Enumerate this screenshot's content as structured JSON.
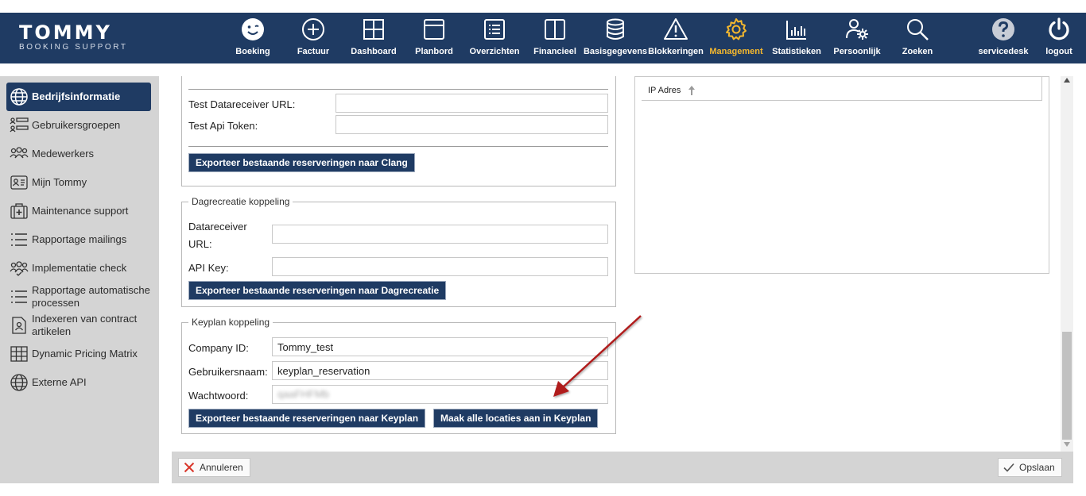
{
  "brand": {
    "name": "TOMMY",
    "subtitle": "BOOKING SUPPORT"
  },
  "nav": {
    "items": [
      {
        "label": "Boeking",
        "icon": "smiley-icon"
      },
      {
        "label": "Factuur",
        "icon": "plus-circle-icon"
      },
      {
        "label": "Dashboard",
        "icon": "grid-icon"
      },
      {
        "label": "Planbord",
        "icon": "window-icon"
      },
      {
        "label": "Overzichten",
        "icon": "list-icon"
      },
      {
        "label": "Financieel",
        "icon": "columns-icon"
      },
      {
        "label": "Basisgegevens",
        "icon": "database-icon"
      },
      {
        "label": "Blokkeringen",
        "icon": "warning-icon"
      },
      {
        "label": "Management",
        "icon": "gear-icon",
        "active": true
      },
      {
        "label": "Statistieken",
        "icon": "bar-chart-icon"
      },
      {
        "label": "Persoonlijk",
        "icon": "user-gear-icon"
      },
      {
        "label": "Zoeken",
        "icon": "search-icon"
      },
      {
        "label": "servicedesk",
        "icon": "help-icon"
      },
      {
        "label": "logout",
        "icon": "power-icon"
      }
    ],
    "active_color": "#f5b82e"
  },
  "sidebar": {
    "items": [
      {
        "label": "Bedrijfsinformatie",
        "icon": "globe-icon",
        "active": true
      },
      {
        "label": "Gebruikersgroepen",
        "icon": "user-groups-icon"
      },
      {
        "label": "Medewerkers",
        "icon": "users-icon"
      },
      {
        "label": "Mijn Tommy",
        "icon": "id-card-icon"
      },
      {
        "label": "Maintenance support",
        "icon": "medkit-icon"
      },
      {
        "label": "Rapportage mailings",
        "icon": "list-icon"
      },
      {
        "label": "Implementatie check",
        "icon": "team-icon"
      },
      {
        "label": "Rapportage automatische processen",
        "icon": "list-icon"
      },
      {
        "label": "Indexeren van contract artikelen",
        "icon": "document-user-icon"
      },
      {
        "label": "Dynamic Pricing Matrix",
        "icon": "table-icon"
      },
      {
        "label": "Externe API",
        "icon": "globe-icon"
      }
    ]
  },
  "clang": {
    "test_datareceiver_label": "Test Datareceiver URL:",
    "test_datareceiver_value": "",
    "test_api_token_label": "Test Api Token:",
    "test_api_token_value": "",
    "export_button": "Exporteer bestaande reserveringen naar Clang"
  },
  "dagrecreatie": {
    "legend": "Dagrecreatie koppeling",
    "datareceiver_label_1": "Datareceiver",
    "datareceiver_label_2": "URL:",
    "datareceiver_value": "",
    "api_key_label": "API Key:",
    "api_key_value": "",
    "export_button": "Exporteer bestaande reserveringen naar Dagrecreatie"
  },
  "keyplan": {
    "legend": "Keyplan koppeling",
    "company_id_label": "Company ID:",
    "company_id_value": "Tommy_test",
    "username_label": "Gebruikersnaam:",
    "username_value": "keyplan_reservation",
    "password_label": "Wachtwoord:",
    "password_value": "qaaFHFMb",
    "export_button": "Exporteer bestaande reserveringen naar Keyplan",
    "create_locations_button": "Maak alle locaties aan in Keyplan"
  },
  "ip_table": {
    "column_header": "IP Adres",
    "sort": "ascending"
  },
  "footer": {
    "cancel_label": "Annuleren",
    "save_label": "Opslaan"
  },
  "colors": {
    "primary": "#1f3b63",
    "accent": "#f5b82e",
    "annotation_arrow": "#b01c1c"
  }
}
